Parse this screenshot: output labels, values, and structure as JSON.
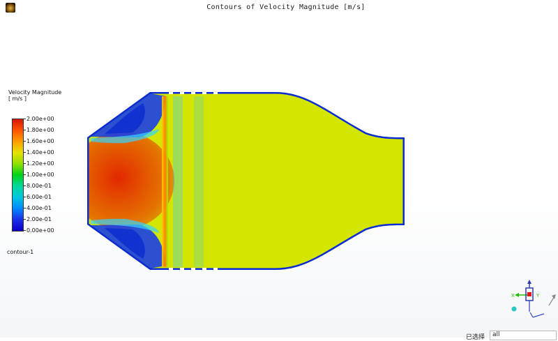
{
  "window": {
    "title": "Contours of Velocity Magnitude [m/s]",
    "logo_icon": "ansys-fluent-logo-icon"
  },
  "colorbar": {
    "title_line1": "Velocity Magnitude",
    "title_line2": "[ m/s ]",
    "ticks": [
      "2.00e+00",
      "1.80e+00",
      "1.60e+00",
      "1.40e+00",
      "1.20e+00",
      "1.00e+00",
      "8.00e-01",
      "6.00e-01",
      "4.00e-01",
      "2.00e-01",
      "0.00e+00"
    ],
    "colors": [
      "#d61600",
      "#ff5500",
      "#ff9d00",
      "#e6e100",
      "#8fe000",
      "#00d21a",
      "#00d89e",
      "#00c6e0",
      "#0088ff",
      "#1b2ee8",
      "#0a00c8"
    ]
  },
  "contour": {
    "name": "contour-1"
  },
  "axes_triad": {
    "x_label": "X",
    "y_label": "Y",
    "icon": "axes-triad-icon"
  },
  "selection": {
    "label": "已选择",
    "value": "all"
  }
}
